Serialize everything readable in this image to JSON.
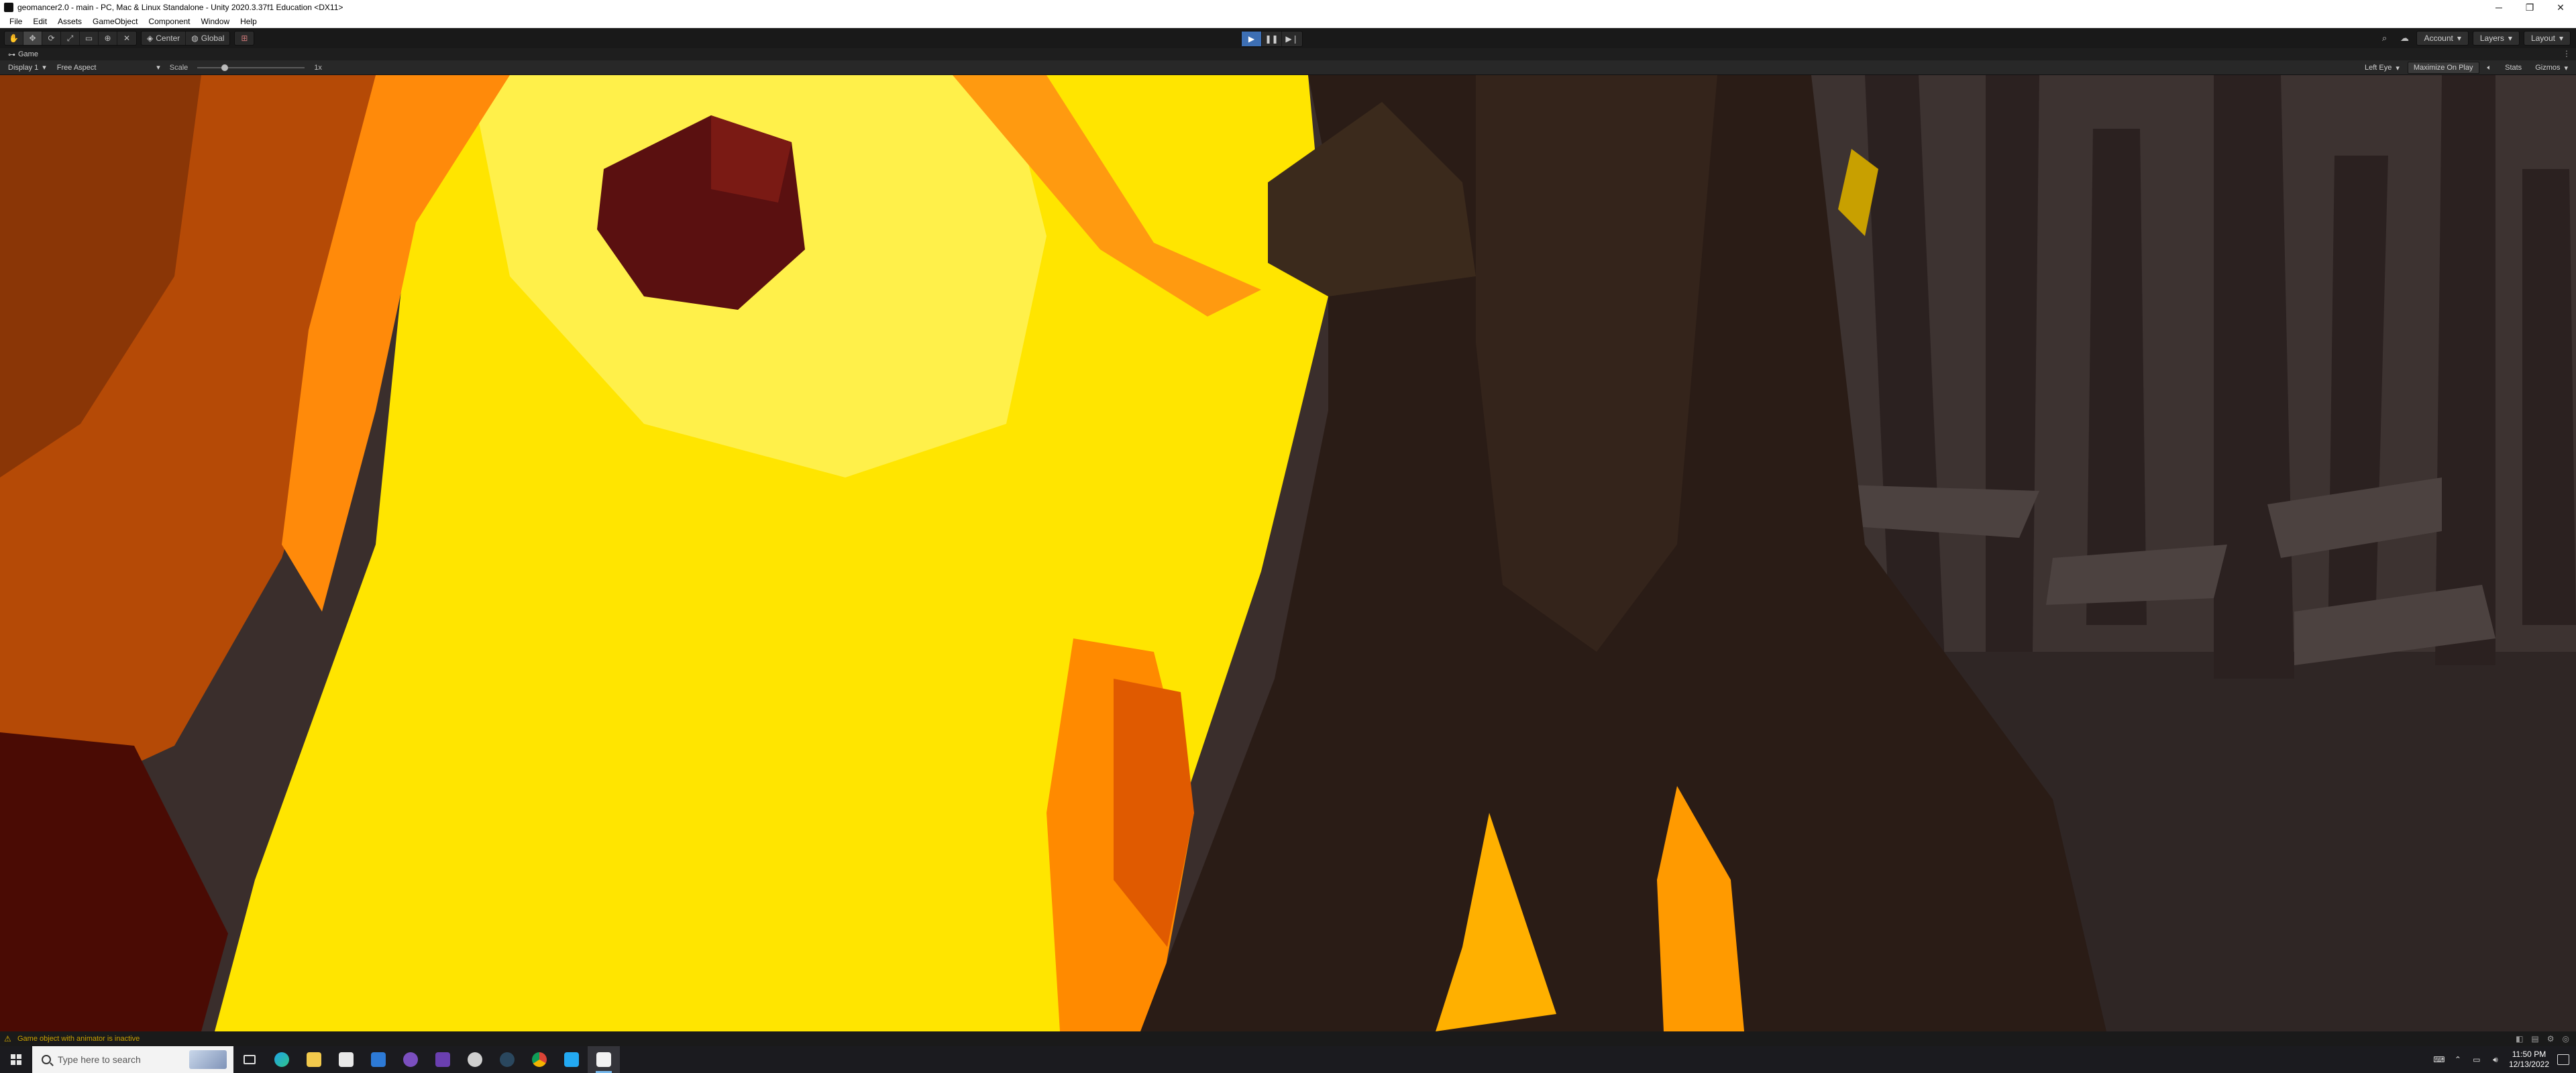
{
  "window": {
    "title": "geomancer2.0 - main - PC, Mac & Linux Standalone - Unity 2020.3.37f1 Education <DX11>",
    "minimize": "─",
    "maximize": "❐",
    "close": "✕"
  },
  "menu": {
    "items": [
      "File",
      "Edit",
      "Assets",
      "GameObject",
      "Component",
      "Window",
      "Help"
    ]
  },
  "toolbar": {
    "tools": [
      "hand-tool",
      "move-tool",
      "rotate-tool",
      "scale-tool",
      "rect-tool",
      "transform-tool",
      "custom-tool"
    ],
    "pivot_label": "Center",
    "space_label": "Global",
    "snap_icon": "snap-icon",
    "account_label": "Account",
    "layers_label": "Layers",
    "layout_label": "Layout",
    "search_icon": "search-icon",
    "cloud_icon": "cloud-icon"
  },
  "playmode": {
    "play": "▶",
    "pause": "❚❚",
    "step": "▶❘",
    "playing": true,
    "accent": "#3d6fb4"
  },
  "game_tab": {
    "label": "Game",
    "icon": "game-controller-icon"
  },
  "game_bar": {
    "display": "Display 1",
    "aspect": "Free Aspect",
    "scale_label": "Scale",
    "scale_value": "1x",
    "eye": "Left Eye",
    "maximize": "Maximize On Play",
    "stats": "Stats",
    "gizmos": "Gizmos"
  },
  "status": {
    "message": "Game object with animator is inactive",
    "warn_color": "#c8a000"
  },
  "taskbar": {
    "search_placeholder": "Type here to search",
    "apps": [
      "task-view",
      "edge",
      "file-explorer",
      "store",
      "mail",
      "github",
      "app-purple",
      "unity-hub",
      "steam",
      "chrome",
      "vscode",
      "unity-editor"
    ],
    "time": "11:50 PM",
    "date": "12/13/2022"
  }
}
